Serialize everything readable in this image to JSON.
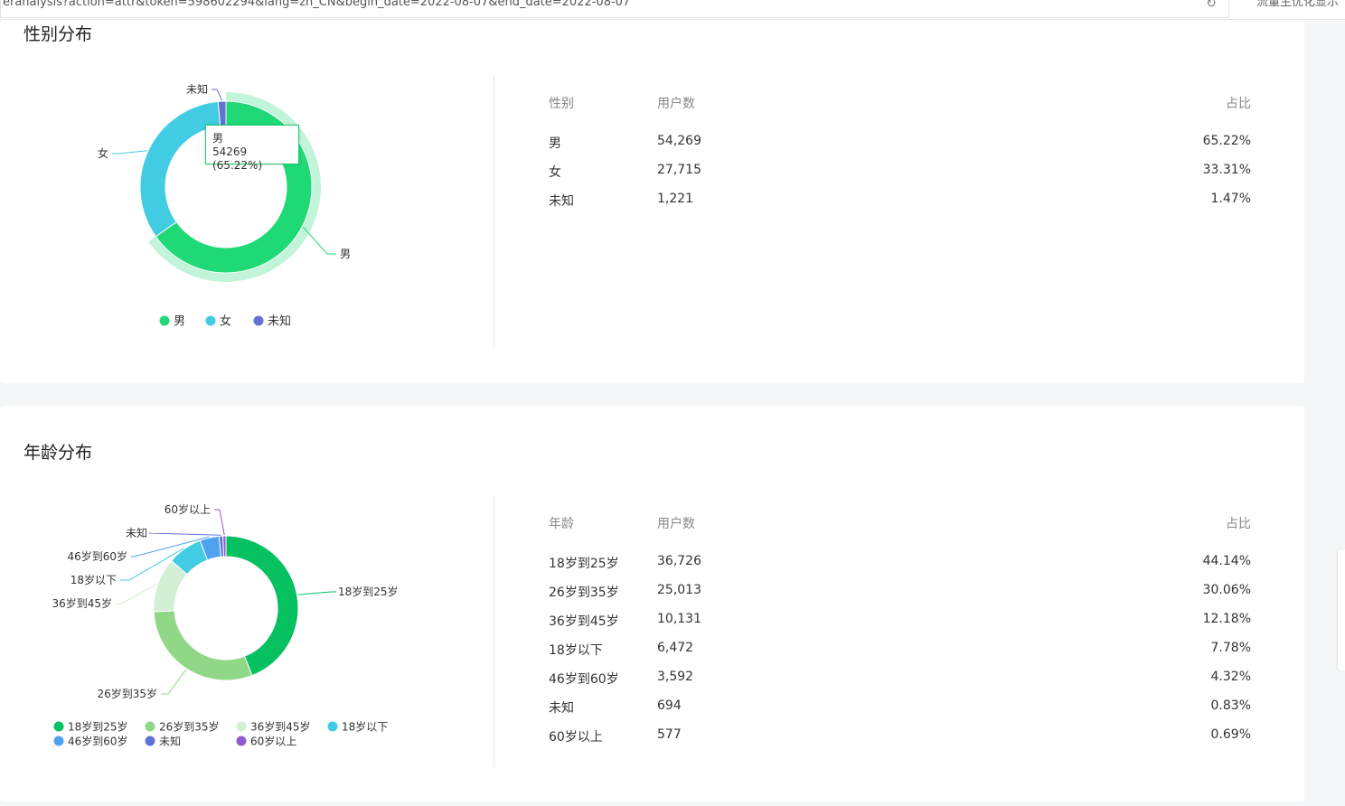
{
  "browser": {
    "url": "eranalysis?action=attr&token=598602294&lang=zh_CN&begin_date=2022-08-07&end_date=2022-08-07",
    "side_text": "流量主优化显示"
  },
  "colors": {
    "male": "#1fd976",
    "female": "#41cce3",
    "unknown": "#6272d4",
    "age": [
      "#07c160",
      "#91d788",
      "#d3efd4",
      "#41cce3",
      "#4ea2ee",
      "#6272d4",
      "#8f5bcd"
    ]
  },
  "gender": {
    "title": "性别分布",
    "table": {
      "headers": [
        "性别",
        "用户数",
        "占比"
      ],
      "rows": [
        {
          "label": "男",
          "users": "54,269",
          "pct": "65.22%"
        },
        {
          "label": "女",
          "users": "27,715",
          "pct": "33.31%"
        },
        {
          "label": "未知",
          "users": "1,221",
          "pct": "1.47%"
        }
      ]
    },
    "tooltip": {
      "label": "男",
      "value": "54269 (65.22%)"
    }
  },
  "age": {
    "title": "年龄分布",
    "table": {
      "headers": [
        "年龄",
        "用户数",
        "占比"
      ],
      "rows": [
        {
          "label": "18岁到25岁",
          "users": "36,726",
          "pct": "44.14%"
        },
        {
          "label": "26岁到35岁",
          "users": "25,013",
          "pct": "30.06%"
        },
        {
          "label": "36岁到45岁",
          "users": "10,131",
          "pct": "12.18%"
        },
        {
          "label": "18岁以下",
          "users": "6,472",
          "pct": "7.78%"
        },
        {
          "label": "46岁到60岁",
          "users": "3,592",
          "pct": "4.32%"
        },
        {
          "label": "未知",
          "users": "694",
          "pct": "0.83%"
        },
        {
          "label": "60岁以上",
          "users": "577",
          "pct": "0.69%"
        }
      ]
    }
  },
  "chart_data": [
    {
      "type": "pie",
      "title": "性别分布",
      "categories": [
        "男",
        "女",
        "未知"
      ],
      "values": [
        54269,
        27715,
        1221
      ],
      "legend": "bottom",
      "highlighted": "男"
    },
    {
      "type": "pie",
      "title": "年龄分布",
      "categories": [
        "18岁到25岁",
        "26岁到35岁",
        "36岁到45岁",
        "18岁以下",
        "46岁到60岁",
        "未知",
        "60岁以上"
      ],
      "values": [
        36726,
        25013,
        10131,
        6472,
        3592,
        694,
        577
      ],
      "legend": "bottom"
    }
  ]
}
